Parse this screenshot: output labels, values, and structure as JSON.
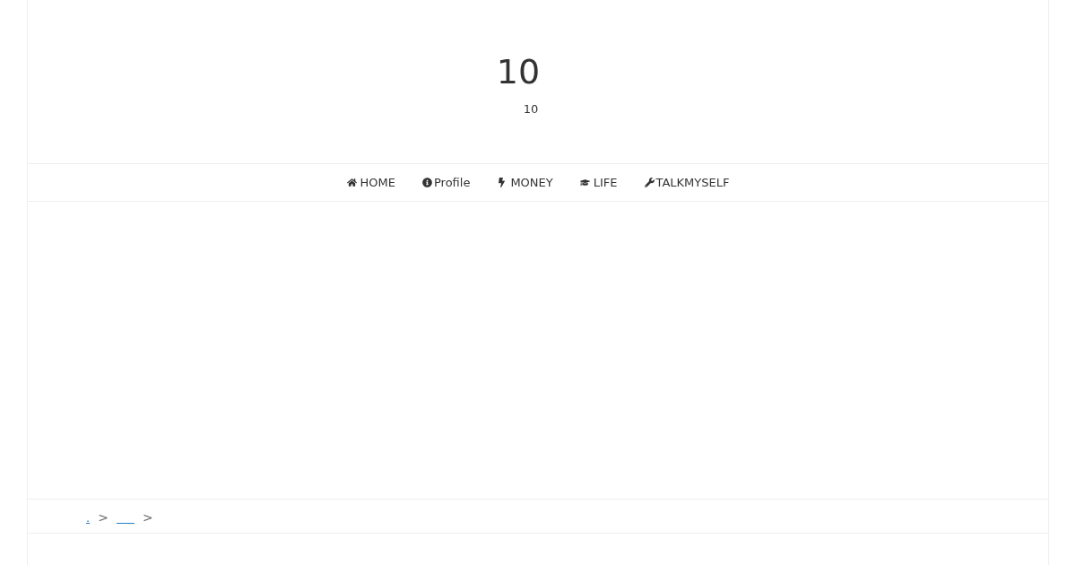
{
  "header": {
    "title": "10",
    "subtitle": "10"
  },
  "nav": {
    "items": [
      {
        "label": "HOME"
      },
      {
        "label": "Profile"
      },
      {
        "label": "MONEY"
      },
      {
        "label": "LIFE"
      },
      {
        "label": "TALKMYSELF"
      }
    ]
  },
  "breadcrumb": {
    "items": [
      {
        "kind": "link",
        "text": "."
      },
      {
        "kind": "separator",
        "text": ">"
      },
      {
        "kind": "blank_link"
      },
      {
        "kind": "separator",
        "text": ">"
      }
    ]
  }
}
